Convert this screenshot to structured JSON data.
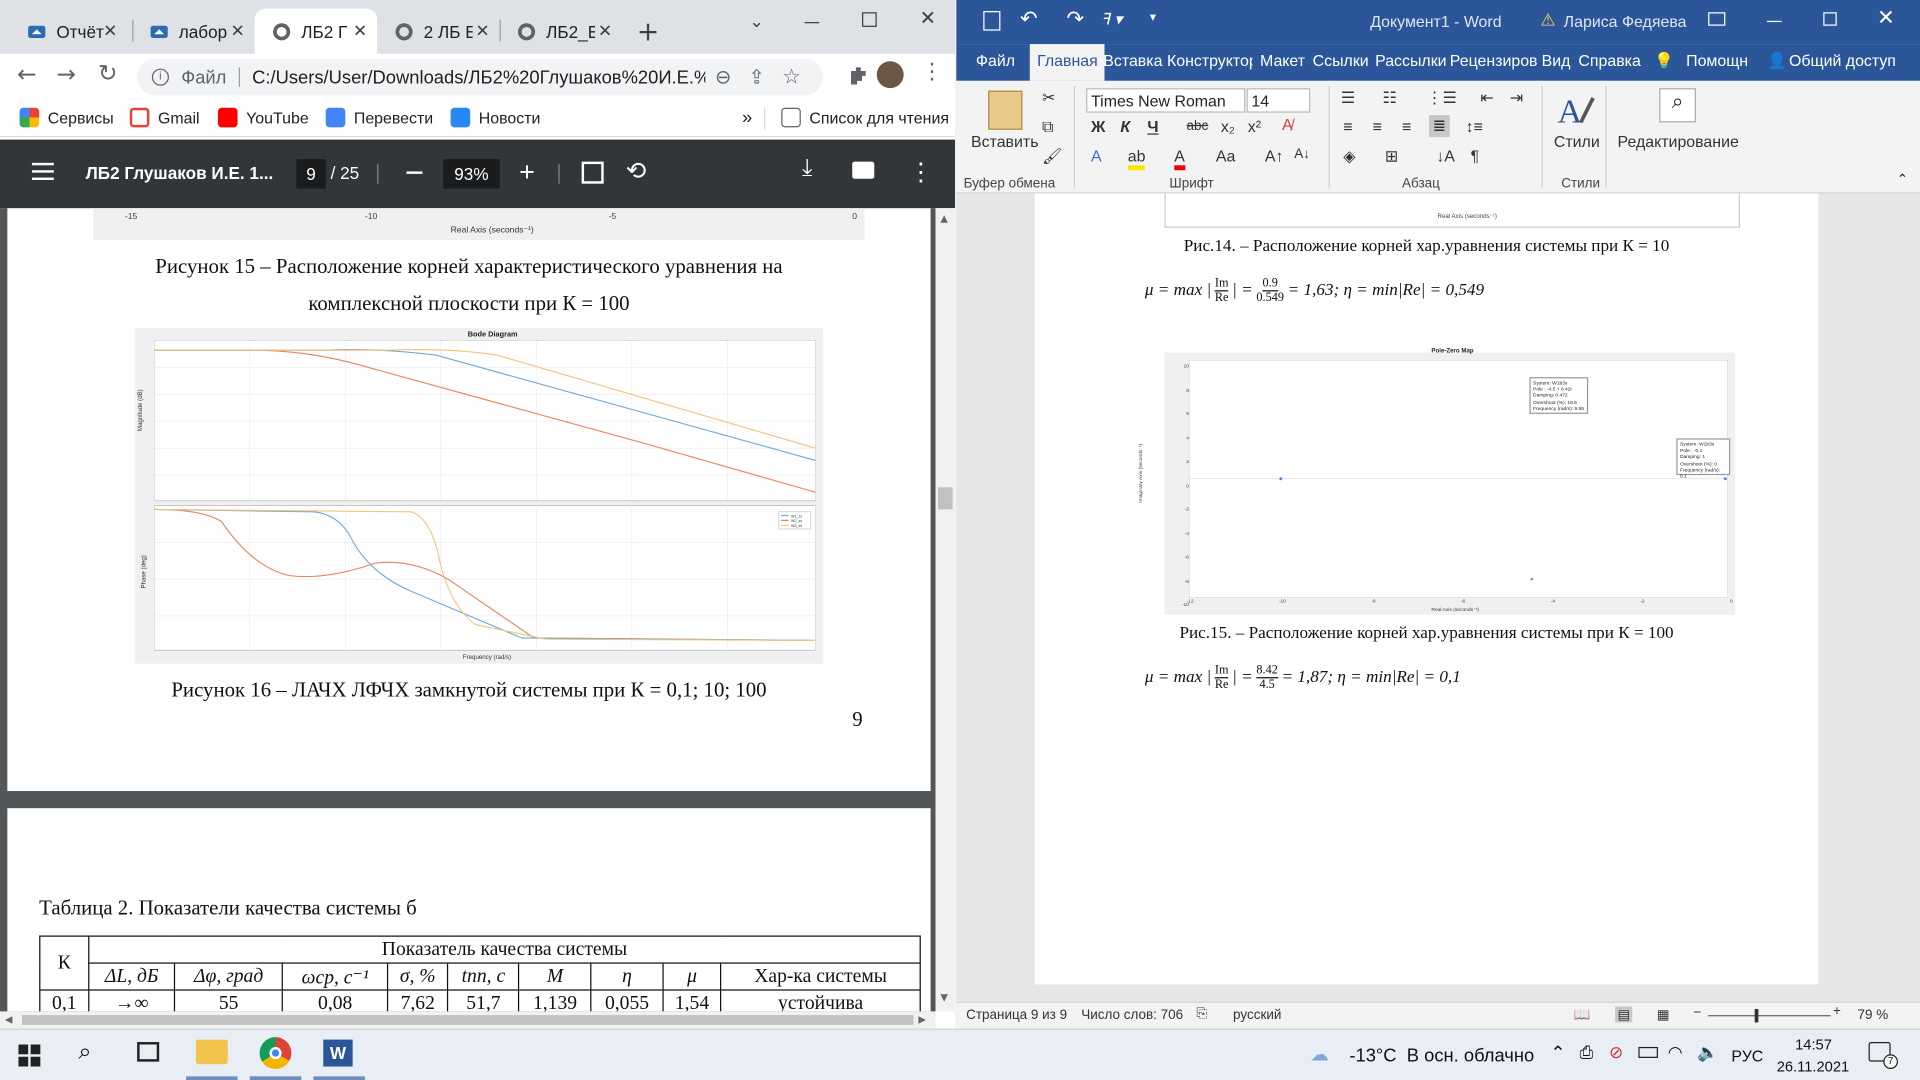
{
  "chrome": {
    "tabs": [
      {
        "label": "Отчёт",
        "active": false
      },
      {
        "label": "лабор",
        "active": false
      },
      {
        "label": "ЛБ2 Г",
        "active": true
      },
      {
        "label": "2 ЛБ Е",
        "active": false
      },
      {
        "label": "ЛБ2_Е",
        "active": false
      }
    ],
    "address_scheme": "Файл",
    "address": "C:/Users/User/Downloads/ЛБ2%20Глушаков%20И.Е.%2...",
    "bookmarks": [
      "Сервисы",
      "Gmail",
      "YouTube",
      "Перевести",
      "Новости"
    ],
    "reading_list": "Список для чтения",
    "more_bookmarks": "»"
  },
  "pdf": {
    "title": "ЛБ2 Глушаков И.Е. 1...",
    "page_current": "9",
    "page_total": "/ 25",
    "zoom": "93%",
    "top_plot_xticks": [
      "-15",
      "-10",
      "-5",
      "0"
    ],
    "top_plot_xlabel": "Real Axis (seconds⁻¹)",
    "caption15_line1": "Рисунок 15 – Расположение корней характеристического уравнения на",
    "caption15_line2": "комплексной плоскости при К = 100",
    "bode_title": "Bode Diagram",
    "bode_ylabel_mag": "Magnitude (dB)",
    "bode_ylabel_phase": "Phase (deg)",
    "bode_xlabel": "Frequency (rad/s)",
    "bode_legend": [
      "W1_zs",
      "W2_zs",
      "W3_zs"
    ],
    "caption16": "Рисунок 16 – ЛАЧХ ЛФЧХ замкнутой системы при К = 0,1; 10; 100",
    "page_number": "9",
    "table_title": "Таблица 2. Показатели качества системы б",
    "table_header_k": "К",
    "table_header_group": "Показатель качества системы",
    "table_columns": [
      "ΔL, дБ",
      "Δφ, град",
      "ωср, с⁻¹",
      "σ, %",
      "tпп, с",
      "M",
      "η",
      "μ",
      "Хар-ка системы"
    ],
    "table_row": [
      "0,1",
      "→∞",
      "55",
      "0,08",
      "7,62",
      "51,7",
      "1,139",
      "0,055",
      "1,54",
      "устойчива"
    ]
  },
  "word": {
    "qat": [
      "save-icon",
      "undo-icon",
      "redo-icon",
      "format-icon"
    ],
    "title": "Документ1 - Word",
    "user": "Лариса Федяева",
    "menu": [
      "Файл",
      "Главная",
      "Вставка",
      "Конструктор",
      "Макет",
      "Ссылки",
      "Рассылки",
      "Рецензиров",
      "Вид",
      "Справка",
      "Помощн",
      "Общий доступ"
    ],
    "font_name": "Times New Roman",
    "font_size": "14",
    "paste_label": "Вставить",
    "styles_label": "Стили",
    "editing_label": "Редактирование",
    "group_clipboard": "Буфер обмена",
    "group_font": "Шрифт",
    "group_paragraph": "Абзац",
    "group_styles": "Стили",
    "fig14_axis_label": "Real Axis (seconds⁻¹)",
    "fig14_caption": "Рис.14. – Расположение корней хар.уравнения системы при К = 10",
    "formula1": {
      "prefix": "μ = max |",
      "frac_num": "Im",
      "frac_den": "Re",
      "mid": "| =",
      "val_num": "0.9",
      "val_den": "0.549",
      "suffix": "= 1,63; η = min|Re| = 0,549"
    },
    "fig15_title": "Pole-Zero Map",
    "fig15_ylabel": "Imaginary Axis (seconds⁻¹)",
    "fig15_xlabel": "Real Axis (seconds⁻¹)",
    "fig15_yticks": [
      "10",
      "8",
      "6",
      "4",
      "2",
      "0",
      "-2",
      "-4",
      "-6",
      "-8",
      "-10"
    ],
    "fig15_xticks": [
      "-12",
      "-10",
      "-8",
      "-6",
      "-4",
      "-2",
      "0"
    ],
    "fig15_tooltip1": [
      "System: W1b3s",
      "Pole : -4.5 + 8.42i",
      "Damping: 0.472",
      "Overshoot (%): 18.6",
      "Frequency (rad/s): 9.55"
    ],
    "fig15_tooltip2": [
      "System: W1b3s",
      "Pole : -0.1",
      "Damping: 1",
      "Overshoot (%): 0",
      "Frequency (rad/s): 0.1"
    ],
    "fig15_caption": "Рис.15. – Расположение корней хар.уравнения системы при К = 100",
    "formula2": {
      "prefix": "μ = max |",
      "frac_num": "Im",
      "frac_den": "Re",
      "mid": "| =",
      "val_num": "8.42",
      "val_den": "4.5",
      "suffix": "= 1,87; η = min|Re| = 0,1"
    },
    "status_page": "Страница 9 из 9",
    "status_words": "Число слов: 706",
    "status_lang": "русский",
    "zoom": "79 %"
  },
  "taskbar": {
    "weather": "-13°C  В осн. облачно",
    "lang": "РУС",
    "time": "14:57",
    "date": "26.11.2021",
    "notifications": "7"
  },
  "colors": {
    "word_blue": "#2b579a",
    "chrome_tabbar": "#dee1e6",
    "pdf_bg": "#525659",
    "pdf_toolbar": "#323639"
  }
}
